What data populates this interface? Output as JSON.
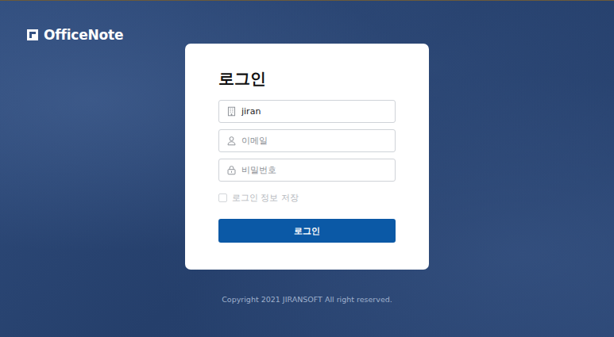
{
  "logo": {
    "text": "OfficeNote"
  },
  "login": {
    "title": "로그인",
    "company": {
      "value": "jiran"
    },
    "email": {
      "placeholder": "이메일"
    },
    "password": {
      "placeholder": "비밀번호"
    },
    "remember": {
      "label": "로그인 정보 저장",
      "checked": false
    },
    "button": "로그인"
  },
  "footer": {
    "copyright": "Copyright 2021 JIRANSOFT All right reserved."
  }
}
